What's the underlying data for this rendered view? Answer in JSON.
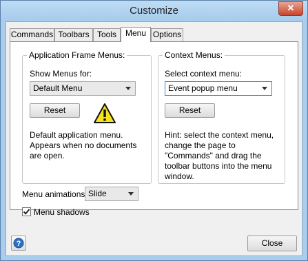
{
  "window": {
    "title": "Customize",
    "close_glyph": "✕"
  },
  "tabs": [
    {
      "label": "Commands"
    },
    {
      "label": "Toolbars"
    },
    {
      "label": "Tools"
    },
    {
      "label": "Menu"
    },
    {
      "label": "Options"
    }
  ],
  "active_tab": "Menu",
  "app_frame": {
    "legend": "Application Frame Menus:",
    "show_for_label": "Show Menus for:",
    "show_for_value": "Default Menu",
    "reset_label": "Reset",
    "warning_icon": "warning-icon",
    "description": "Default application menu. Appears when no documents are open."
  },
  "context": {
    "legend": "Context Menus:",
    "select_label": "Select context menu:",
    "select_value": "Event popup menu",
    "reset_label": "Reset",
    "hint": "Hint: select the context menu, change the page to \"Commands\" and drag the toolbar buttons into the menu window."
  },
  "menu_animations": {
    "label": "Menu animations:",
    "value": "Slide"
  },
  "menu_shadows": {
    "label": "Menu shadows",
    "checked": true
  },
  "footer": {
    "help_icon": "help-icon",
    "close_label": "Close"
  }
}
